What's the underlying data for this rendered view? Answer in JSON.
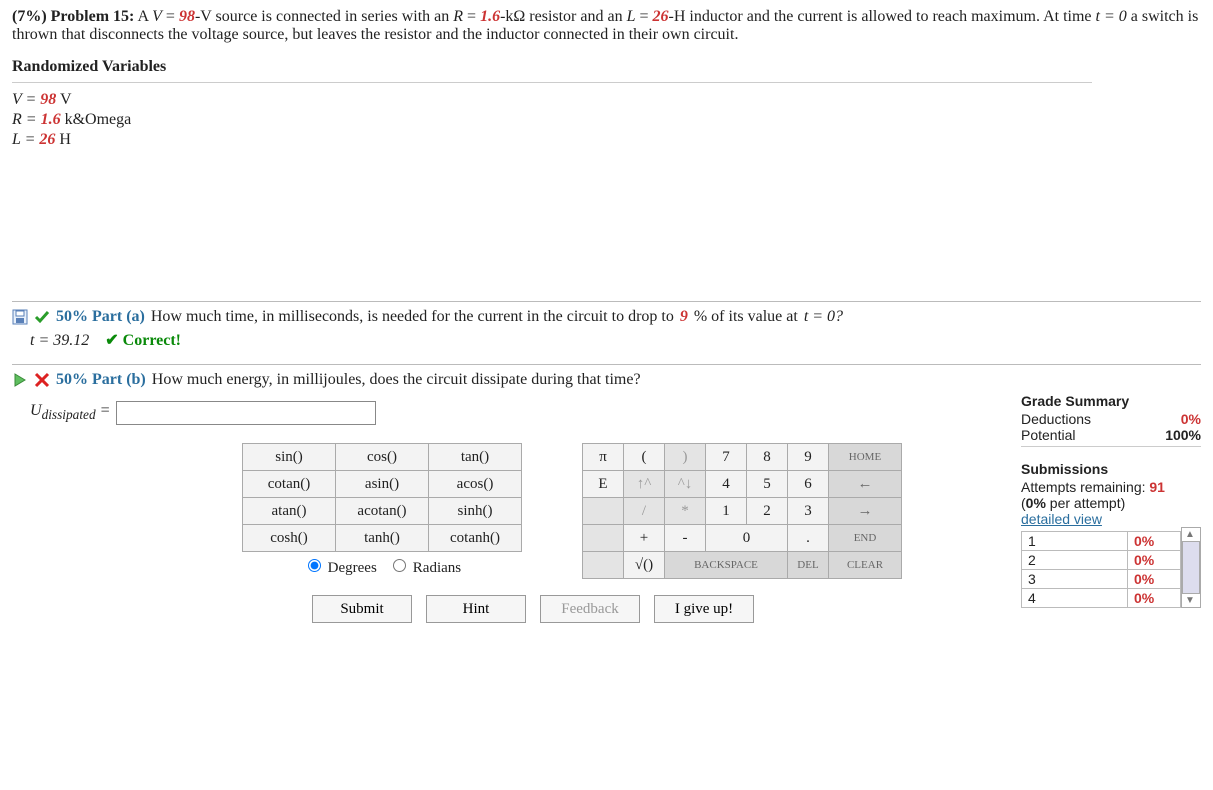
{
  "problem": {
    "weight_label": "(7%)  Problem 15:",
    "text_pre": "A ",
    "V_label": "V",
    "eq": " = ",
    "V_value": "98",
    "text_mid1": "-V source is connected in series with an ",
    "R_label": "R",
    "R_value": "1.6",
    "text_mid2": "-kΩ resistor and an ",
    "L_label": "L",
    "L_value": "26",
    "text_mid3": "-H inductor and the current is allowed to reach maximum. At time ",
    "t0": "t = 0",
    "text_end": " a switch is thrown that disconnects the voltage source, but leaves the resistor and the inductor connected in their own circuit."
  },
  "rv": {
    "title": "Randomized Variables",
    "V_line_pre": "V = ",
    "V_val": "98",
    "V_unit": " V",
    "R_line_pre": "R = ",
    "R_val": "1.6",
    "R_unit": " k&Omega",
    "L_line_pre": "L = ",
    "L_val": "26",
    "L_unit": " H"
  },
  "partA": {
    "label": "50% Part (a)",
    "question_pre": "How much time, in milliseconds, is needed for the current in the circuit to drop to ",
    "drop_pct": "9",
    "question_post": " % of its value at ",
    "t0": "t = 0?",
    "answer_var": "t = 39.12",
    "correct_label": "✔ Correct!"
  },
  "partB": {
    "label": "50% Part (b)",
    "question": "How much energy, in millijoules, does the circuit dissipate during that time?",
    "answer_var": "U",
    "answer_sub": "dissipated",
    "equals": " = "
  },
  "funcpad": {
    "r1": [
      "sin()",
      "cos()",
      "tan()"
    ],
    "r2": [
      "cotan()",
      "asin()",
      "acos()"
    ],
    "r3": [
      "atan()",
      "acotan()",
      "sinh()"
    ],
    "r4": [
      "cosh()",
      "tanh()",
      "cotanh()"
    ],
    "modeA": "Degrees",
    "modeB": "Radians"
  },
  "numpad": {
    "r1": [
      "π",
      "(",
      ")",
      "7",
      "8",
      "9",
      "HOME"
    ],
    "r2": [
      "E",
      "↑^",
      "^↓",
      "4",
      "5",
      "6",
      "←"
    ],
    "r3": [
      "",
      "/",
      "*",
      "1",
      "2",
      "3",
      "→"
    ],
    "r4": [
      "",
      "+",
      "-",
      "0",
      "",
      ".",
      "END"
    ],
    "r5": [
      "",
      "√()",
      "BACKSPACE",
      "DEL",
      "CLEAR"
    ]
  },
  "actions": {
    "submit": "Submit",
    "hint": "Hint",
    "feedback": "Feedback",
    "giveup": "I give up!"
  },
  "grade": {
    "title": "Grade Summary",
    "ded_label": "Deductions",
    "ded_val": "0%",
    "pot_label": "Potential",
    "pot_val": "100%"
  },
  "subs": {
    "title": "Submissions",
    "attempts_label": "Attempts remaining: ",
    "attempts_val": "91",
    "per_label": "(",
    "per_val": "0%",
    "per_post": " per attempt)",
    "detailed": "detailed view",
    "rows": [
      {
        "n": "1",
        "p": "0%"
      },
      {
        "n": "2",
        "p": "0%"
      },
      {
        "n": "3",
        "p": "0%"
      },
      {
        "n": "4",
        "p": "0%"
      }
    ]
  }
}
